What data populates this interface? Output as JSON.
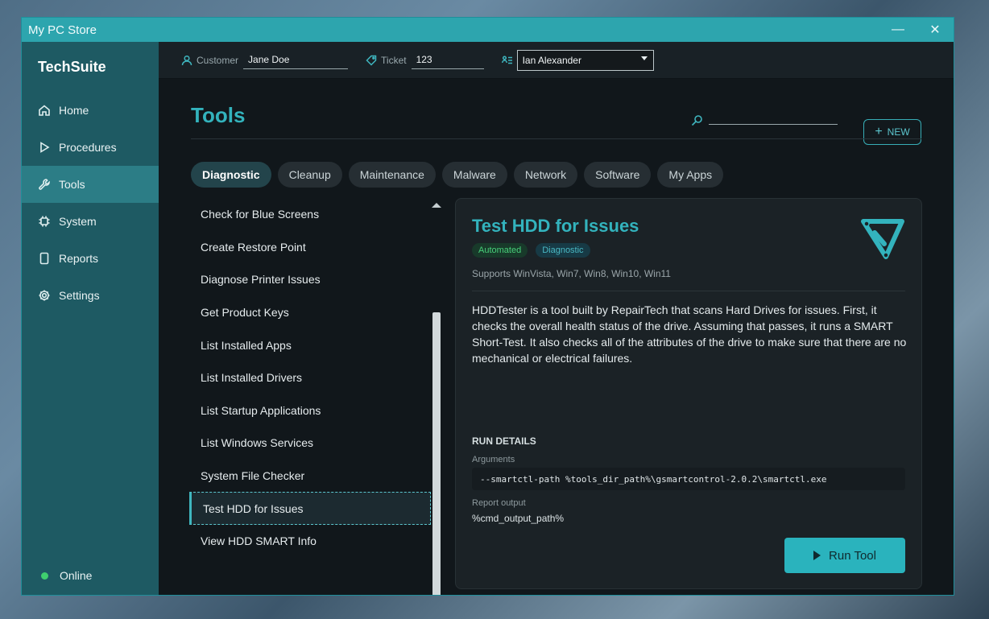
{
  "window": {
    "title": "My PC Store",
    "minimize_glyph": "—",
    "close_glyph": "✕"
  },
  "sidebar": {
    "brand": "TechSuite",
    "items": [
      {
        "label": "Home",
        "icon": "home-icon"
      },
      {
        "label": "Procedures",
        "icon": "play-icon"
      },
      {
        "label": "Tools",
        "icon": "wrench-icon"
      },
      {
        "label": "System",
        "icon": "chip-icon"
      },
      {
        "label": "Reports",
        "icon": "document-icon"
      },
      {
        "label": "Settings",
        "icon": "gear-icon"
      }
    ],
    "active_item": "Tools",
    "status": {
      "label": "Online",
      "color": "#3fcf6f"
    }
  },
  "topbar": {
    "customer_label": "Customer",
    "customer_value": "Jane Doe",
    "ticket_label": "Ticket",
    "ticket_value": "123",
    "technician_value": "Ian Alexander"
  },
  "page": {
    "title": "Tools",
    "search_placeholder": "",
    "new_plus": "+",
    "new_label": "NEW"
  },
  "tabs": [
    "Diagnostic",
    "Cleanup",
    "Maintenance",
    "Malware",
    "Network",
    "Software",
    "My Apps"
  ],
  "active_tab": "Diagnostic",
  "tool_list": [
    "Check for Blue Screens",
    "Create Restore Point",
    "Diagnose Printer Issues",
    "Get Product Keys",
    "List Installed Apps",
    "List Installed Drivers",
    "List Startup Applications",
    "List Windows Services",
    "System File Checker",
    "Test HDD for Issues",
    "View HDD SMART Info"
  ],
  "selected_tool": "Test HDD for Issues",
  "detail": {
    "title": "Test HDD for Issues",
    "badges": [
      "Automated",
      "Diagnostic"
    ],
    "supports": "Supports WinVista, Win7, Win8, Win10, Win11",
    "description": "HDDTester is a tool built by RepairTech that scans Hard Drives for issues. First, it checks the overall health status of the drive. Assuming that passes, it runs a SMART Short-Test. It also checks all of the attributes of the drive to make sure that there are no mechanical or electrical failures.",
    "run_details_title": "RUN DETAILS",
    "arguments_label": "Arguments",
    "arguments": "--smartctl-path %tools_dir_path%\\gsmartcontrol-2.0.2\\smartctl.exe",
    "report_output_label": "Report output",
    "report_output": "%cmd_output_path%",
    "run_button": "Run Tool"
  },
  "colors": {
    "accent": "#33b3bd",
    "titlebar": "#2da5ae",
    "sidebar": "#1e5a63",
    "sidebar_active": "#2c7d86"
  }
}
